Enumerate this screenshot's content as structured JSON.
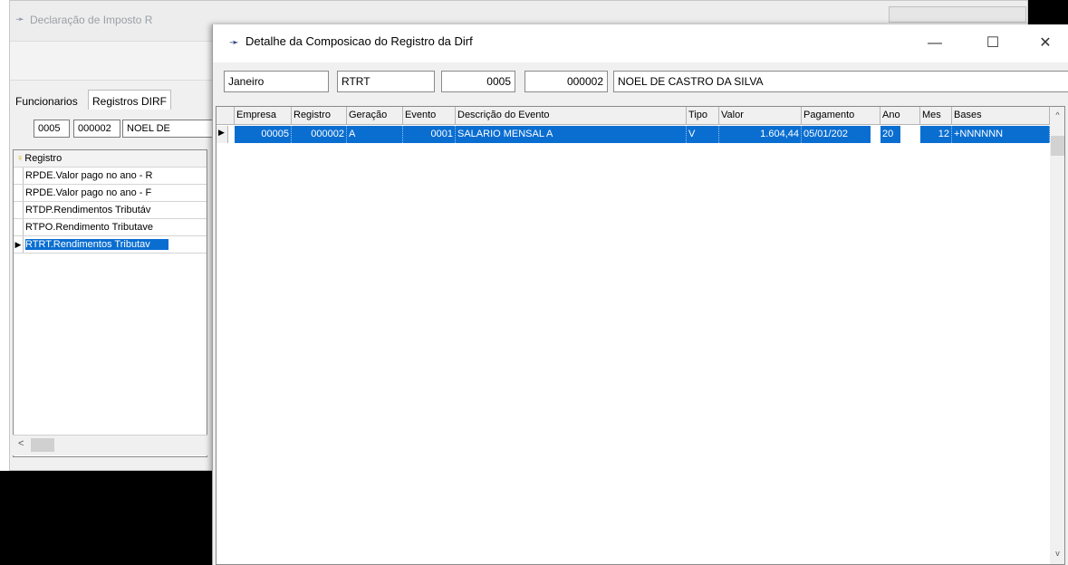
{
  "background_window": {
    "title": "Declaração de Imposto R",
    "tabs": [
      "Funcionarios",
      "Registros DIRF"
    ],
    "empresa": "0005",
    "funcionario_codigo": "000002",
    "funcionario_nome": "NOEL DE",
    "list_header": "Registro",
    "list_items": [
      "RPDE.Valor pago no ano - R",
      "RPDE.Valor pago no ano - F",
      "RTDP.Rendimentos Tributáv",
      "RTPO.Rendimento Tributave",
      "RTRT.Rendimentos Tributav"
    ],
    "selected_index": 4,
    "hscroll_left": "<"
  },
  "dialog": {
    "title": "Detalhe da Composicao do Registro da Dirf",
    "controls": {
      "minimize": "—",
      "maximize": "☐",
      "close": "✕"
    },
    "mes": "Janeiro",
    "registro": "RTRT",
    "empresa": "0005",
    "funcionario_codigo": "000002",
    "funcionario_nome": "NOEL DE CASTRO DA SILVA",
    "grid": {
      "columns": [
        "Empresa",
        "Registro",
        "Geração",
        "Evento",
        "Descrição do Evento",
        "Tipo",
        "Valor",
        "Pagamento",
        "Ano",
        "Mes",
        "Bases"
      ],
      "rows": [
        [
          "00005",
          "000002",
          "A",
          "0001",
          "SALARIO MENSAL A",
          "V",
          "1.604,44",
          "05/01/202",
          "20",
          "12",
          "+NNNNNN"
        ]
      ]
    },
    "scroll_up": "^",
    "scroll_down": "v"
  },
  "colors": {
    "selection": "#0a6ed1",
    "title_arrow": "#2d3e7d"
  }
}
